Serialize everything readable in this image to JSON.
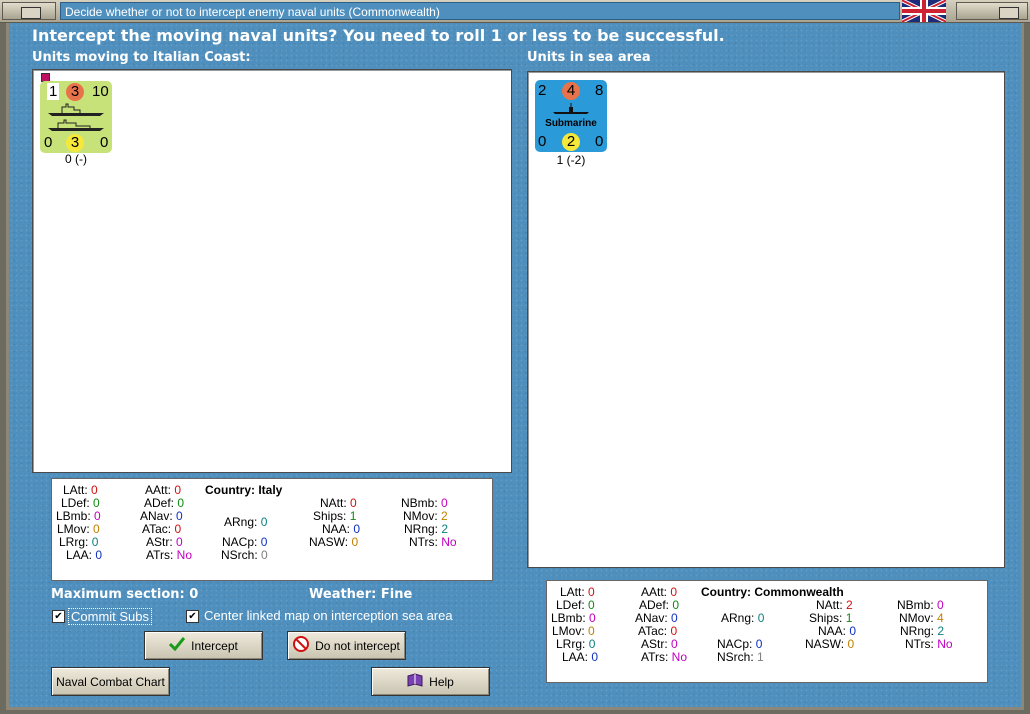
{
  "window": {
    "title": "Decide whether or not to intercept enemy naval units (Commonwealth)"
  },
  "heading": "Intercept the moving naval units?  You need to roll 1 or less to be successful.",
  "left_panel": {
    "label": "Units moving to Italian Coast:",
    "unit": {
      "top_left": "1",
      "top_mid": "3",
      "top_right": "10",
      "bot_left": "0",
      "bot_mid": "3",
      "bot_right": "0",
      "under": "0 (-)",
      "color": "#c8e27a"
    }
  },
  "right_panel": {
    "label": "Units in sea area",
    "unit": {
      "top_left": "2",
      "top_mid": "4",
      "top_right": "8",
      "caption": "Submarine",
      "bot_left": "0",
      "bot_mid": "2",
      "bot_right": "0",
      "under": "1 (-2)",
      "color": "#2a9ad8"
    }
  },
  "italy_stats": {
    "country": "Country: Italy",
    "LAtt": "0",
    "LDef": "0",
    "LBmb": "0",
    "LMov": "0",
    "LRrg": "0",
    "LAA": "0",
    "AAtt": "0",
    "ADef": "0",
    "ANav": "0",
    "ATac": "0",
    "AStr": "0",
    "ATrs": "No",
    "ARng": "0",
    "NACp": "0",
    "NSrch": "0",
    "NAtt": "0",
    "Ships": "1",
    "NAA": "0",
    "NASW": "0",
    "NBmb": "0",
    "NMov": "2",
    "NRng": "2",
    "NTrs": "No"
  },
  "cw_stats": {
    "country": "Country: Commonwealth",
    "LAtt": "0",
    "LDef": "0",
    "LBmb": "0",
    "LMov": "0",
    "LRrg": "0",
    "LAA": "0",
    "AAtt": "0",
    "ADef": "0",
    "ANav": "0",
    "ATac": "0",
    "AStr": "0",
    "ATrs": "No",
    "ARng": "0",
    "NACp": "0",
    "NSrch": "1",
    "NAtt": "2",
    "Ships": "1",
    "NAA": "0",
    "NASW": "0",
    "NBmb": "0",
    "NMov": "4",
    "NRng": "2",
    "NTrs": "No"
  },
  "info": {
    "max_section": "Maximum section: 0",
    "weather": "Weather:  Fine"
  },
  "checkboxes": {
    "commit_subs": "Commit Subs",
    "center_map": "Center linked map on interception sea area"
  },
  "buttons": {
    "intercept": "Intercept",
    "do_not_intercept": "Do not intercept",
    "naval_chart": "Naval Combat Chart",
    "help": "Help"
  }
}
